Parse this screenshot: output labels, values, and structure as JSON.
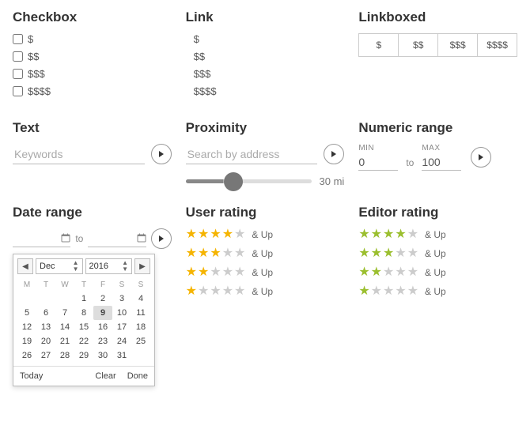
{
  "checkbox": {
    "title": "Checkbox",
    "items": [
      "$",
      "$$",
      "$$$",
      "$$$$"
    ]
  },
  "link": {
    "title": "Link",
    "items": [
      "$",
      "$$",
      "$$$",
      "$$$$"
    ]
  },
  "linkboxed": {
    "title": "Linkboxed",
    "items": [
      "$",
      "$$",
      "$$$",
      "$$$$"
    ]
  },
  "text": {
    "title": "Text",
    "placeholder": "Keywords"
  },
  "proximity": {
    "title": "Proximity",
    "placeholder": "Search by address",
    "value_label": "30 mi"
  },
  "numeric": {
    "title": "Numeric range",
    "min_label": "MIN",
    "max_label": "MAX",
    "to": "to",
    "min_value": "0",
    "max_value": "100"
  },
  "daterange": {
    "title": "Date range",
    "to": "to",
    "month": "Dec",
    "year": "2016",
    "selected_day": 9,
    "dow": [
      "M",
      "T",
      "W",
      "T",
      "F",
      "S",
      "S"
    ],
    "weeks": [
      [
        "",
        "",
        "",
        1,
        2,
        3,
        4
      ],
      [
        5,
        6,
        7,
        8,
        9,
        10,
        11
      ],
      [
        12,
        13,
        14,
        15,
        16,
        17,
        18
      ],
      [
        19,
        20,
        21,
        22,
        23,
        24,
        25
      ],
      [
        26,
        27,
        28,
        29,
        30,
        31,
        ""
      ]
    ],
    "today": "Today",
    "clear": "Clear",
    "done": "Done"
  },
  "user_rating": {
    "title": "User rating",
    "suffix": "& Up",
    "rows": [
      4,
      3,
      2,
      1
    ]
  },
  "editor_rating": {
    "title": "Editor rating",
    "suffix": "& Up",
    "rows": [
      4,
      3,
      2,
      1
    ]
  }
}
